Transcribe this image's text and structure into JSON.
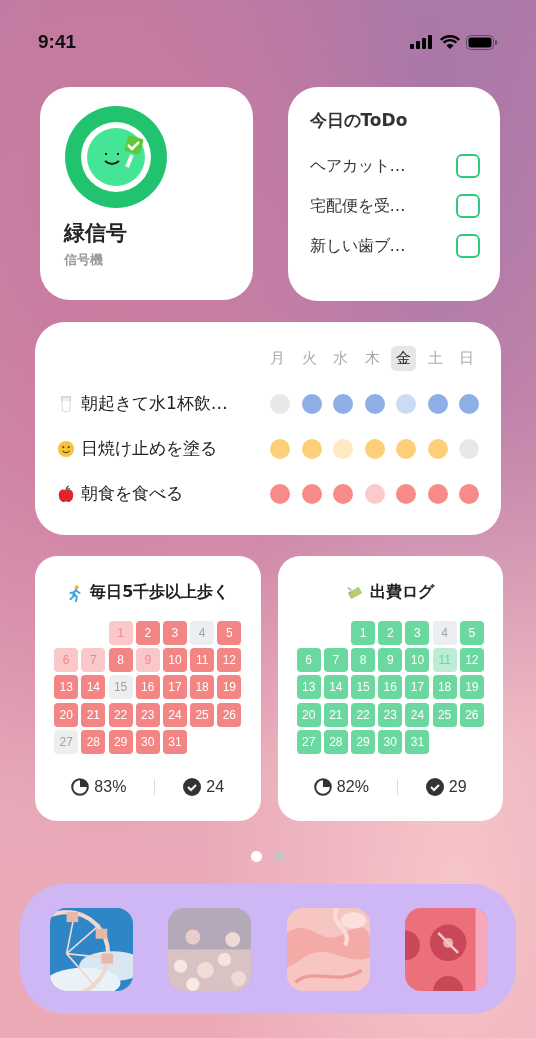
{
  "status_bar": {
    "time": "9:41"
  },
  "signal_widget": {
    "title": "緑信号",
    "subtitle": "信号機"
  },
  "todo_widget": {
    "title": "今日のToDo",
    "items": [
      {
        "label": "ヘアカット…",
        "checked": false
      },
      {
        "label": "宅配便を受…",
        "checked": false
      },
      {
        "label": "新しい歯ブ…",
        "checked": false
      }
    ]
  },
  "habit_widget": {
    "weekdays": [
      {
        "label": "月",
        "selected": false
      },
      {
        "label": "火",
        "selected": false
      },
      {
        "label": "水",
        "selected": false
      },
      {
        "label": "木",
        "selected": false
      },
      {
        "label": "金",
        "selected": true
      },
      {
        "label": "土",
        "selected": false
      },
      {
        "label": "日",
        "selected": false
      }
    ],
    "habits": [
      {
        "kind": "glass",
        "label": "朝起きて水1杯飲…",
        "color": "#8eaee6",
        "marks": [
          {
            "kind": "empty"
          },
          {
            "kind": "done"
          },
          {
            "kind": "done"
          },
          {
            "kind": "done"
          },
          {
            "kind": "light"
          },
          {
            "kind": "done"
          },
          {
            "kind": "done"
          }
        ]
      },
      {
        "kind": "smiley",
        "label": "日焼け止めを塗る",
        "color": "#fccf78",
        "marks": [
          {
            "kind": "done"
          },
          {
            "kind": "done"
          },
          {
            "kind": "light"
          },
          {
            "kind": "done"
          },
          {
            "kind": "done"
          },
          {
            "kind": "done"
          },
          {
            "kind": "empty"
          }
        ]
      },
      {
        "kind": "apple",
        "label": "朝食を食べる",
        "color": "#f88a8a",
        "marks": [
          {
            "kind": "done"
          },
          {
            "kind": "done"
          },
          {
            "kind": "done"
          },
          {
            "kind": "light"
          },
          {
            "kind": "done"
          },
          {
            "kind": "done"
          },
          {
            "kind": "done"
          }
        ]
      }
    ]
  },
  "calendars": [
    {
      "kind": "runner",
      "title": "毎日5千歩以上歩く",
      "color": "#f48585",
      "percent": "83%",
      "count": "24",
      "days": [
        {
          "kind": "blank"
        },
        {
          "kind": "blank"
        },
        {
          "label": "1",
          "kind": "light"
        },
        {
          "label": "2",
          "kind": "done"
        },
        {
          "label": "3",
          "kind": "done"
        },
        {
          "label": "4",
          "kind": "empty"
        },
        {
          "label": "5",
          "kind": "done"
        },
        {
          "label": "6",
          "kind": "light"
        },
        {
          "label": "7",
          "kind": "light"
        },
        {
          "label": "8",
          "kind": "done"
        },
        {
          "label": "9",
          "kind": "light"
        },
        {
          "label": "10",
          "kind": "done"
        },
        {
          "label": "11",
          "kind": "done"
        },
        {
          "label": "12",
          "kind": "done"
        },
        {
          "label": "13",
          "kind": "done"
        },
        {
          "label": "14",
          "kind": "done"
        },
        {
          "label": "15",
          "kind": "empty"
        },
        {
          "label": "16",
          "kind": "done"
        },
        {
          "label": "17",
          "kind": "done"
        },
        {
          "label": "18",
          "kind": "done"
        },
        {
          "label": "19",
          "kind": "done"
        },
        {
          "label": "20",
          "kind": "done"
        },
        {
          "label": "21",
          "kind": "done"
        },
        {
          "label": "22",
          "kind": "done"
        },
        {
          "label": "23",
          "kind": "done"
        },
        {
          "label": "24",
          "kind": "done"
        },
        {
          "label": "25",
          "kind": "done"
        },
        {
          "label": "26",
          "kind": "done"
        },
        {
          "label": "27",
          "kind": "empty"
        },
        {
          "label": "28",
          "kind": "done"
        },
        {
          "label": "29",
          "kind": "done"
        },
        {
          "label": "30",
          "kind": "done"
        },
        {
          "label": "31",
          "kind": "done"
        }
      ]
    },
    {
      "kind": "money",
      "title": "出費ログ",
      "color": "#6bd8a0",
      "percent": "82%",
      "count": "29",
      "days": [
        {
          "kind": "blank"
        },
        {
          "kind": "blank"
        },
        {
          "label": "1",
          "kind": "done"
        },
        {
          "label": "2",
          "kind": "done"
        },
        {
          "label": "3",
          "kind": "done"
        },
        {
          "label": "4",
          "kind": "empty"
        },
        {
          "label": "5",
          "kind": "done"
        },
        {
          "label": "6",
          "kind": "done"
        },
        {
          "label": "7",
          "kind": "done"
        },
        {
          "label": "8",
          "kind": "done"
        },
        {
          "label": "9",
          "kind": "done"
        },
        {
          "label": "10",
          "kind": "done"
        },
        {
          "label": "11",
          "kind": "light"
        },
        {
          "label": "12",
          "kind": "done"
        },
        {
          "label": "13",
          "kind": "done"
        },
        {
          "label": "14",
          "kind": "done"
        },
        {
          "label": "15",
          "kind": "done"
        },
        {
          "label": "16",
          "kind": "done"
        },
        {
          "label": "17",
          "kind": "done"
        },
        {
          "label": "18",
          "kind": "done"
        },
        {
          "label": "19",
          "kind": "done"
        },
        {
          "label": "20",
          "kind": "done"
        },
        {
          "label": "21",
          "kind": "done"
        },
        {
          "label": "22",
          "kind": "done"
        },
        {
          "label": "23",
          "kind": "done"
        },
        {
          "label": "24",
          "kind": "done"
        },
        {
          "label": "25",
          "kind": "done"
        },
        {
          "label": "26",
          "kind": "done"
        },
        {
          "label": "27",
          "kind": "done"
        },
        {
          "label": "28",
          "kind": "done"
        },
        {
          "label": "29",
          "kind": "done"
        },
        {
          "label": "30",
          "kind": "done"
        },
        {
          "label": "31",
          "kind": "done"
        }
      ]
    }
  ],
  "page_dots": [
    {
      "selected": true
    },
    {
      "selected": false
    }
  ]
}
